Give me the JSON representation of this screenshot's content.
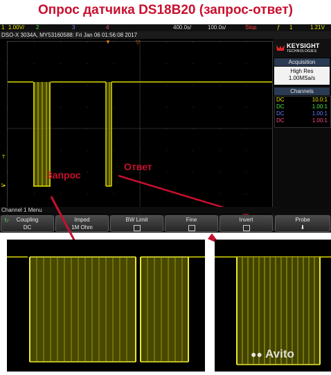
{
  "page_title": "Опрос датчика DS18B20 (запрос-ответ)",
  "scope": {
    "status_bar": {
      "ch1_scale": "1.00V/",
      "ch2": "2",
      "ch3": "3",
      "ch4": "4",
      "timebase": "400.0s/",
      "delay": "100.0s/",
      "run_state": "Stop",
      "trigger_ch": "1",
      "trigger_level": "1.21V"
    },
    "info_bar": "DSO-X 3034A, MY53160588: Fri Jan 06 01:56:08 2017",
    "annotations": {
      "request": "Запрос",
      "response": "Ответ"
    },
    "panel": {
      "brand": "KEYSIGHT",
      "brand_sub": "TECHNOLOGIES",
      "acquisition_title": "Acquisition",
      "acq_mode": "High Res",
      "acq_rate": "1.00MSa/s",
      "channels_title": "Channels",
      "channels": [
        {
          "coupling": "DC",
          "ratio": "10.0:1",
          "color": "#e6e600"
        },
        {
          "coupling": "DC",
          "ratio": "1.00:1",
          "color": "#4ee84e"
        },
        {
          "coupling": "DC",
          "ratio": "1.00:1",
          "color": "#6a7cff"
        },
        {
          "coupling": "DC",
          "ratio": "1.00:1",
          "color": "#ff4a8a"
        }
      ]
    },
    "menu_title": "Channel 1 Menu",
    "softkeys": [
      {
        "key": "Coupling",
        "value": "DC"
      },
      {
        "key": "Imped",
        "value": "1M Ohm"
      },
      {
        "key": "BW Limit",
        "value": ""
      },
      {
        "key": "Fine",
        "value": ""
      },
      {
        "key": "Invert",
        "value": ""
      },
      {
        "key": "Probe",
        "value": ""
      }
    ]
  },
  "colors": {
    "title_red": "#c8102e",
    "trace_yellow": "#d9d900"
  },
  "watermark": "Avito"
}
